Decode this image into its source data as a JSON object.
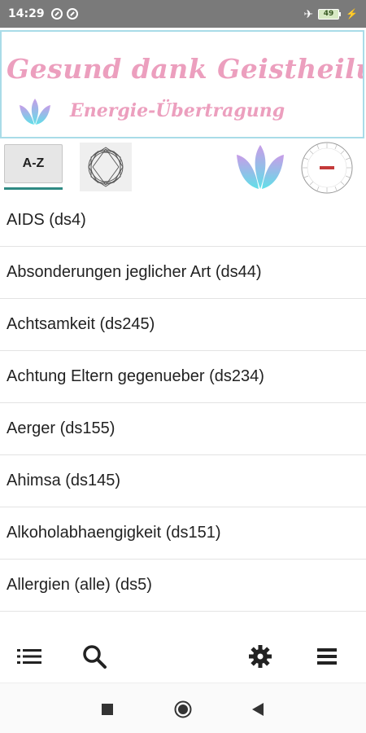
{
  "status_bar": {
    "time": "14:29",
    "battery_level": "49",
    "icons": [
      "notification-icon",
      "notification-icon",
      "airplane-mode-icon",
      "battery-icon",
      "charging-icon"
    ]
  },
  "banner": {
    "title": "Gesund dank Geistheilung",
    "subtitle": "Energie-Übertragung",
    "colors": {
      "text": "#ec9fbe",
      "border": "#a9dce8",
      "lotus_top": "#c89ce8",
      "lotus_bottom": "#5fe0e8"
    }
  },
  "toolbar": {
    "az_label": "A-Z",
    "icons": [
      "mandala-icon",
      "lotus-icon",
      "dial-chart-icon"
    ],
    "accent": "#2f8a83"
  },
  "list": {
    "items": [
      "AIDS (ds4)",
      "Absonderungen jeglicher Art (ds44)",
      "Achtsamkeit (ds245)",
      "Achtung Eltern gegenueber (ds234)",
      "Aerger (ds155)",
      "Ahimsa (ds145)",
      "Alkoholabhaengigkeit (ds151)",
      "Allergien (alle) (ds5)"
    ]
  },
  "bottom_nav": {
    "icons": [
      "list-icon",
      "search-icon",
      "settings-icon",
      "menu-icon"
    ]
  },
  "system_nav": {
    "icons": [
      "recent-apps-icon",
      "home-icon",
      "back-icon"
    ]
  }
}
